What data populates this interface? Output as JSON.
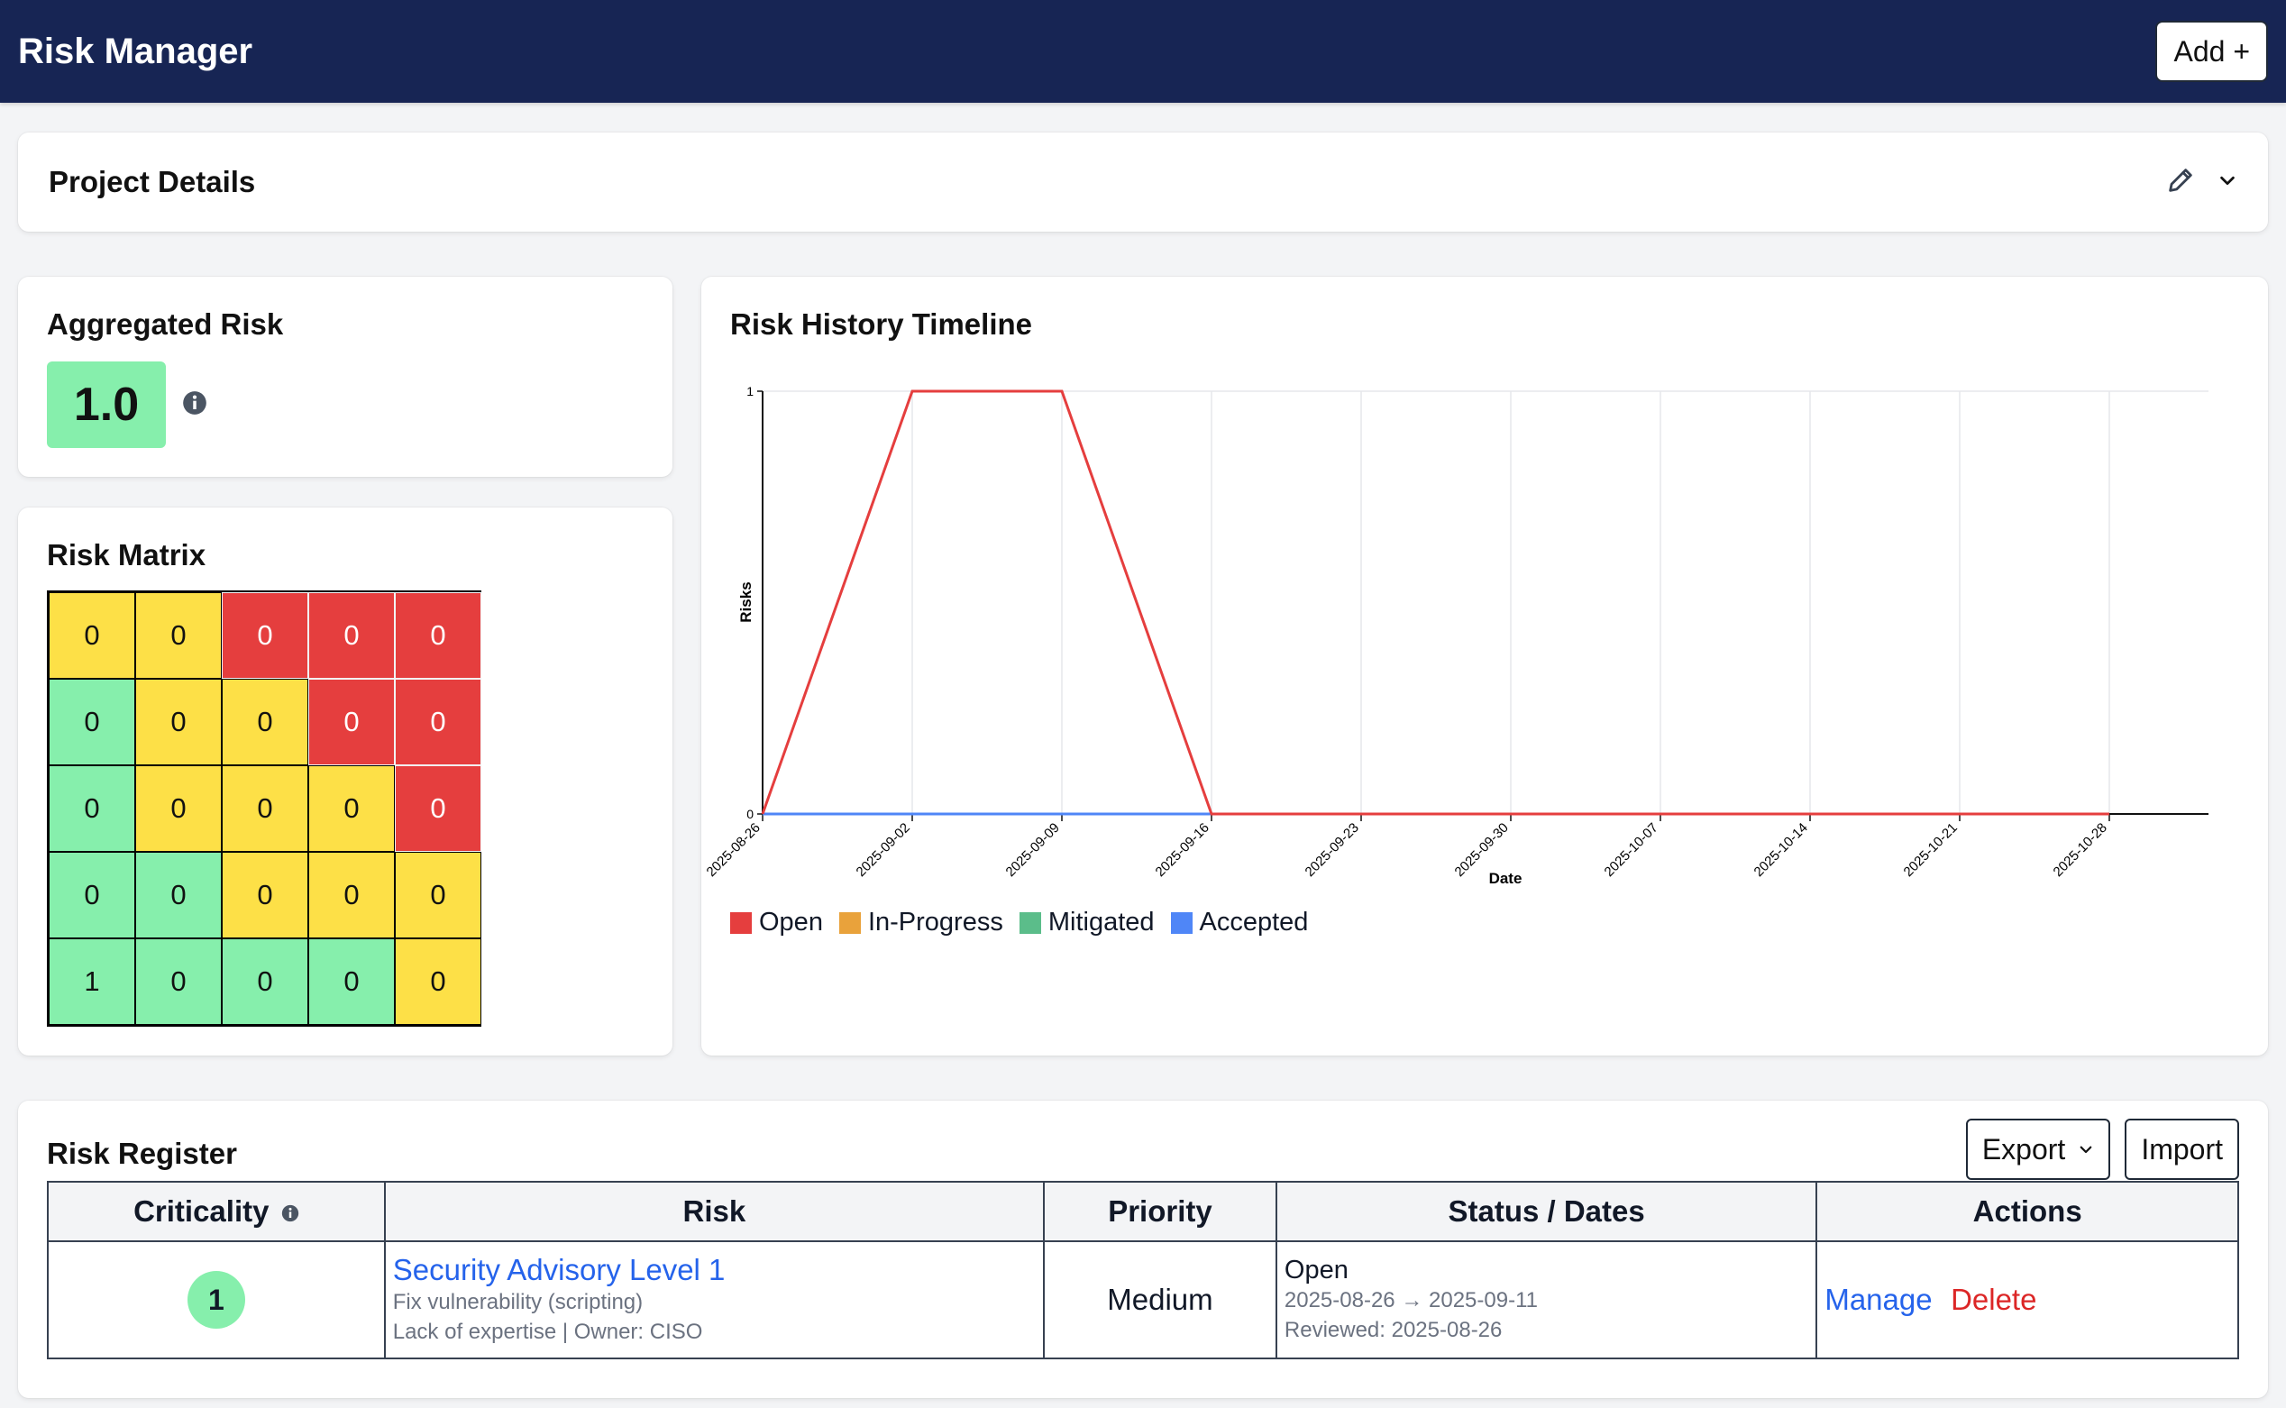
{
  "header": {
    "title": "Risk Manager",
    "add_label": "Add +"
  },
  "project": {
    "title": "Project Details",
    "edit_icon": "pencil-icon",
    "expand_icon": "chevron-down-icon"
  },
  "aggregated": {
    "title": "Aggregated Risk",
    "value": "1.0",
    "info_icon": "info-icon",
    "color": "#86efac"
  },
  "matrix": {
    "title": "Risk Matrix",
    "rows": [
      [
        {
          "v": "0",
          "c": "yellow"
        },
        {
          "v": "0",
          "c": "yellow"
        },
        {
          "v": "0",
          "c": "red"
        },
        {
          "v": "0",
          "c": "red"
        },
        {
          "v": "0",
          "c": "red"
        }
      ],
      [
        {
          "v": "0",
          "c": "green"
        },
        {
          "v": "0",
          "c": "yellow"
        },
        {
          "v": "0",
          "c": "yellow"
        },
        {
          "v": "0",
          "c": "red"
        },
        {
          "v": "0",
          "c": "red"
        }
      ],
      [
        {
          "v": "0",
          "c": "green"
        },
        {
          "v": "0",
          "c": "yellow"
        },
        {
          "v": "0",
          "c": "yellow"
        },
        {
          "v": "0",
          "c": "yellow"
        },
        {
          "v": "0",
          "c": "red"
        }
      ],
      [
        {
          "v": "0",
          "c": "green"
        },
        {
          "v": "0",
          "c": "green"
        },
        {
          "v": "0",
          "c": "yellow"
        },
        {
          "v": "0",
          "c": "yellow"
        },
        {
          "v": "0",
          "c": "yellow"
        }
      ],
      [
        {
          "v": "1",
          "c": "green"
        },
        {
          "v": "0",
          "c": "green"
        },
        {
          "v": "0",
          "c": "green"
        },
        {
          "v": "0",
          "c": "green"
        },
        {
          "v": "0",
          "c": "yellow"
        }
      ]
    ]
  },
  "timeline": {
    "title": "Risk History Timeline"
  },
  "chart_data": {
    "type": "line",
    "xlabel": "Date",
    "ylabel": "Risks",
    "x": [
      "2025-08-26",
      "2025-09-02",
      "2025-09-09",
      "2025-09-16",
      "2025-09-23",
      "2025-09-30",
      "2025-10-07",
      "2025-10-14",
      "2025-10-21",
      "2025-10-28"
    ],
    "yticks": [
      "0",
      "1"
    ],
    "ylim": [
      0,
      1
    ],
    "grid": true,
    "legend_position": "bottom-left",
    "series": [
      {
        "name": "Open",
        "color": "#e53e3e",
        "values": [
          0,
          1,
          1,
          0,
          0,
          0,
          0,
          0,
          0,
          0
        ]
      },
      {
        "name": "In-Progress",
        "color": "#e9a23b",
        "values": [
          0,
          0,
          0,
          0,
          0,
          0,
          0,
          0,
          0,
          0
        ]
      },
      {
        "name": "Mitigated",
        "color": "#5bbd8a",
        "values": [
          0,
          0,
          0,
          0,
          0,
          0,
          0,
          0,
          0,
          0
        ]
      },
      {
        "name": "Accepted",
        "color": "#4f86f7",
        "values": [
          0,
          0,
          0,
          0,
          0,
          0,
          0,
          0,
          0,
          0
        ]
      }
    ]
  },
  "register": {
    "title": "Risk Register",
    "export_label": "Export",
    "import_label": "Import",
    "columns": [
      "Criticality",
      "Risk",
      "Priority",
      "Status / Dates",
      "Actions"
    ],
    "rows": [
      {
        "criticality": "1",
        "risk_title": "Security Advisory Level 1",
        "risk_desc": "Fix vulnerability (scripting)",
        "risk_meta": "Lack of expertise | Owner: CISO",
        "priority": "Medium",
        "status": "Open",
        "dates": "2025-08-26 → 2025-09-11",
        "reviewed": "Reviewed: 2025-08-26",
        "manage": "Manage",
        "delete": "Delete"
      }
    ]
  }
}
